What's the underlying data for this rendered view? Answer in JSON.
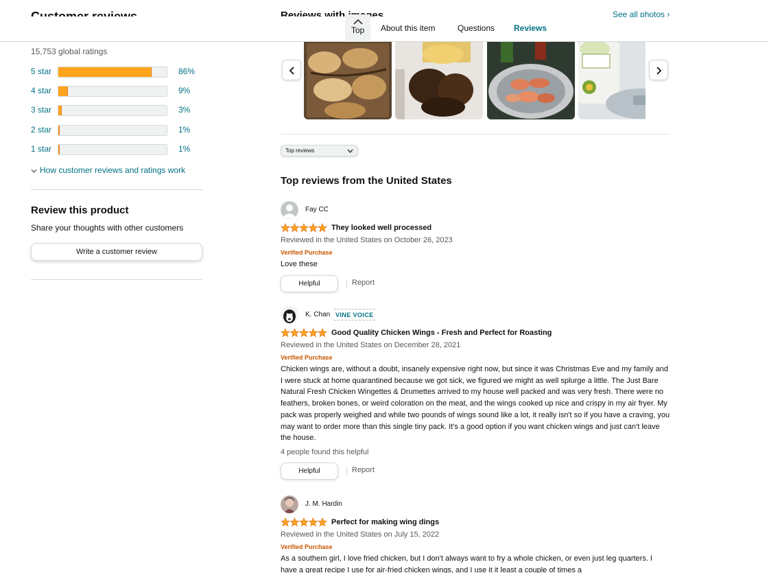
{
  "nav": {
    "top_label": "Top",
    "links": [
      "About this item",
      "Questions",
      "Reviews"
    ],
    "active": "Reviews"
  },
  "cutoff": {
    "left_heading": "Customer reviews",
    "right_heading": "Reviews with images",
    "see_all": "See all photos ›"
  },
  "ratings": {
    "global": "15,753 global ratings",
    "rows": [
      {
        "label": "5 star",
        "percent": 86,
        "percent_text": "86%"
      },
      {
        "label": "4 star",
        "percent": 9,
        "percent_text": "9%"
      },
      {
        "label": "3 star",
        "percent": 3,
        "percent_text": "3%"
      },
      {
        "label": "2 star",
        "percent": 1,
        "percent_text": "1%"
      },
      {
        "label": "1 star",
        "percent": 1,
        "percent_text": "1%"
      }
    ],
    "how_link": "How customer reviews and ratings work"
  },
  "review_product": {
    "heading": "Review this product",
    "subtext": "Share your thoughts with other customers",
    "button": "Write a customer review"
  },
  "images": {
    "thumb_icons": [
      "roasted-wings-image",
      "grilled-wings-image",
      "spiced-raw-wings-image",
      "packaged-wings-image"
    ]
  },
  "sort": {
    "selected": "Top reviews"
  },
  "reviews_heading": "Top reviews from the United States",
  "reviews": [
    {
      "name": "Fay CC",
      "vine": "",
      "rating": 5,
      "title": "They looked well processed",
      "date": "Reviewed in the United States on October 26, 2023",
      "verified": "Verified Purchase",
      "body": "Love these",
      "helpful_count": "",
      "helpful_label": "Helpful",
      "report_label": "Report",
      "avatar": "default-avatar-icon"
    },
    {
      "name": "K. Chan",
      "vine": "VINE VOICE",
      "rating": 5,
      "title": "Good Quality Chicken Wings - Fresh and Perfect for Roasting",
      "date": "Reviewed in the United States on December 28, 2021",
      "verified": "Verified Purchase",
      "body": "Chicken wings are, without a doubt, insanely expensive right now, but since it was Christmas Eve and my family and I were stuck at home quarantined because we got sick, we figured we might as well splurge a little. The Just Bare Natural Fresh Chicken Wingettes & Drumettes arrived to my house well packed and was very fresh. There were no feathers, broken bones, or weird coloration on the meat, and the wings cooked up nice and crispy in my air fryer. My pack was properly weighed and while two pounds of wings sound like a lot, it really isn't so if you have a craving, you may want to order more than this single tiny pack. It's a good option if you want chicken wings and just can't leave the house.",
      "helpful_count": "4 people found this helpful",
      "helpful_label": "Helpful",
      "report_label": "Report",
      "avatar": "dog-photo-avatar"
    },
    {
      "name": "J. M. Hardin",
      "vine": "",
      "rating": 5,
      "title": "Perfect for making wing dings",
      "date": "Reviewed in the United States on July 15, 2022",
      "verified": "Verified Purchase",
      "body": "As a southern girl, I love fried chicken, but I don't always want to fry a whole chicken, or even just leg quarters. I have a great recipe I use for air-fried chicken wings, and I use it it least a couple of times a",
      "helpful_count": "",
      "helpful_label": "Helpful",
      "report_label": "Report",
      "avatar": "person-photo-avatar"
    }
  ],
  "colors": {
    "link": "#007185",
    "star": "#ffa41c",
    "verified": "#c45500",
    "text": "#0f1111",
    "muted": "#565959"
  }
}
